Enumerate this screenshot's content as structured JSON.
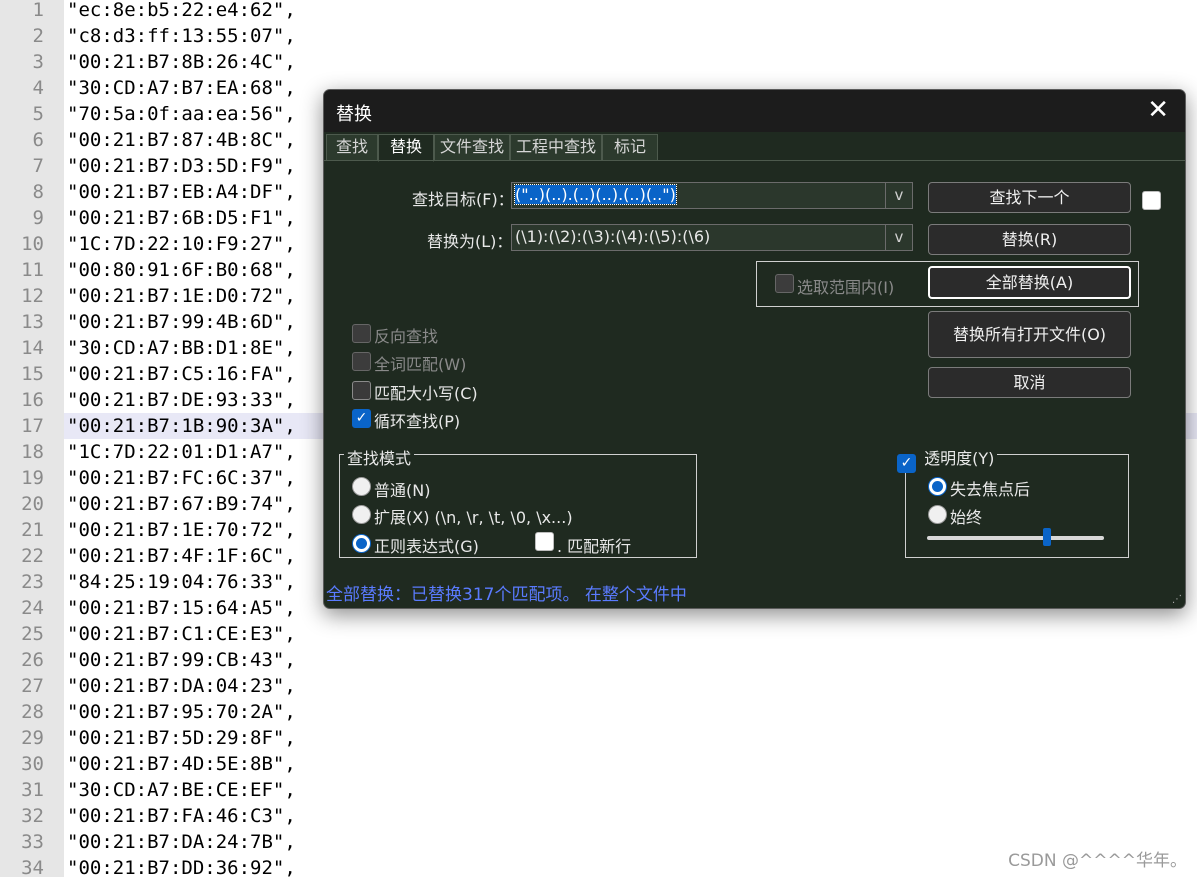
{
  "editor": {
    "line_numbers": [
      "1",
      "2",
      "3",
      "4",
      "5",
      "6",
      "7",
      "8",
      "9",
      "10",
      "11",
      "12",
      "13",
      "14",
      "15",
      "16",
      "17",
      "18",
      "19",
      "20",
      "21",
      "22",
      "23",
      "24",
      "25",
      "26",
      "27",
      "28",
      "29",
      "30",
      "31",
      "32",
      "33",
      "34"
    ],
    "lines": [
      "\"ec:8e:b5:22:e4:62\",",
      "\"c8:d3:ff:13:55:07\",",
      "\"00:21:B7:8B:26:4C\",",
      "\"30:CD:A7:B7:EA:68\",",
      "\"70:5a:0f:aa:ea:56\",",
      "\"00:21:B7:87:4B:8C\",",
      "\"00:21:B7:D3:5D:F9\",",
      "\"00:21:B7:EB:A4:DF\",",
      "\"00:21:B7:6B:D5:F1\",",
      "\"1C:7D:22:10:F9:27\",",
      "\"00:80:91:6F:B0:68\",",
      "\"00:21:B7:1E:D0:72\",",
      "\"00:21:B7:99:4B:6D\",",
      "\"30:CD:A7:BB:D1:8E\",",
      "\"00:21:B7:C5:16:FA\",",
      "\"00:21:B7:DE:93:33\",",
      "\"00:21:B7:1B:90:3A\",",
      "\"1C:7D:22:01:D1:A7\",",
      "\"00:21:B7:FC:6C:37\",",
      "\"00:21:B7:67:B9:74\",",
      "\"00:21:B7:1E:70:72\",",
      "\"00:21:B7:4F:1F:6C\",",
      "\"84:25:19:04:76:33\",",
      "\"00:21:B7:15:64:A5\",",
      "\"00:21:B7:C1:CE:E3\",",
      "\"00:21:B7:99:CB:43\",",
      "\"00:21:B7:DA:04:23\",",
      "\"00:21:B7:95:70:2A\",",
      "\"00:21:B7:5D:29:8F\",",
      "\"00:21:B7:4D:5E:8B\",",
      "\"30:CD:A7:BE:CE:EF\",",
      "\"00:21:B7:FA:46:C3\",",
      "\"00:21:B7:DA:24:7B\",",
      "\"00:21:B7:DD:36:92\","
    ],
    "current_line": 17,
    "watermark": "CSDN @^^^^华年。"
  },
  "dialog": {
    "title": "替换",
    "tabs": [
      "查找",
      "替换",
      "文件查找",
      "工程中查找",
      "标记"
    ],
    "active_tab": "替换",
    "find_label": "查找目标(F)：",
    "find_value": "(\"..)(..).(..)(..).(..)(..\")",
    "replace_label": "替换为(L)：",
    "replace_value": "(\\1):(\\2):(\\3):(\\4):(\\5):(\\6)",
    "buttons": {
      "find_next": "查找下一个",
      "replace": "替换(R)",
      "replace_all": "全部替换(A)",
      "replace_all_open": "替换所有打开文件(O)",
      "cancel": "取消"
    },
    "in_selection": "选取范围内(I)",
    "options": {
      "backward": "反向查找",
      "whole_word": "全词匹配(W)",
      "match_case": "匹配大小写(C)",
      "wrap_around": "循环查找(P)"
    },
    "search_mode": {
      "title": "查找模式",
      "normal": "普通(N)",
      "extended": "扩展(X) (\\n, \\r, \\t, \\0, \\x...)",
      "regex": "正则表达式(G)",
      "dot_newline": ". 匹配新行"
    },
    "transparency": {
      "title": "透明度(Y)",
      "on_lose_focus": "失去焦点后",
      "always": "始终",
      "level": 0.68
    },
    "status": "全部替换：已替换317个匹配项。 在整个文件中"
  }
}
